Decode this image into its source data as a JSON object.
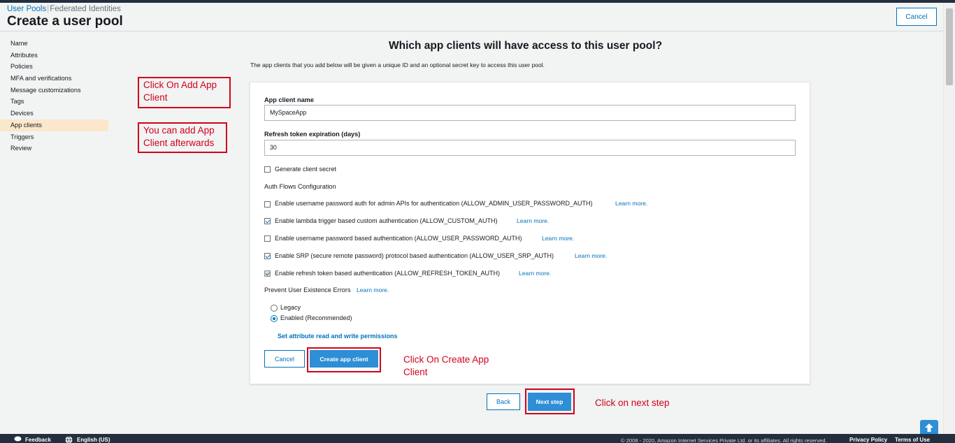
{
  "breadcrumb": {
    "user_pools": "User Pools",
    "federated": "Federated Identities"
  },
  "page_title": "Create a user pool",
  "header": {
    "cancel": "Cancel"
  },
  "sidebar": {
    "items": [
      {
        "label": "Name"
      },
      {
        "label": "Attributes"
      },
      {
        "label": "Policies"
      },
      {
        "label": "MFA and verifications"
      },
      {
        "label": "Message customizations"
      },
      {
        "label": "Tags"
      },
      {
        "label": "Devices"
      },
      {
        "label": "App clients",
        "active": true
      },
      {
        "label": "Triggers"
      },
      {
        "label": "Review"
      }
    ]
  },
  "annotations": {
    "add_app_client": "Click On Add App Client",
    "add_afterwards": "You can add App Client afterwards",
    "create_app_client": "Click On Create App Client",
    "next_step": "Click on next step"
  },
  "main": {
    "title": "Which app clients will have access to this user pool?",
    "description": "The app clients that you add below will be given a unique ID and an optional secret key to access this user pool."
  },
  "form": {
    "app_client_name_label": "App client name",
    "app_client_name_value": "MySpaceApp",
    "refresh_label": "Refresh token expiration (days)",
    "refresh_value": "30",
    "generate_secret": "Generate client secret",
    "auth_flows_heading": "Auth Flows Configuration",
    "auth_flows": [
      {
        "label": "Enable username password auth for admin APIs for authentication (ALLOW_ADMIN_USER_PASSWORD_AUTH)",
        "checked": false,
        "learn": "Learn more."
      },
      {
        "label": "Enable lambda trigger based custom authentication (ALLOW_CUSTOM_AUTH)",
        "checked": true,
        "learn": "Learn more."
      },
      {
        "label": "Enable username password based authentication (ALLOW_USER_PASSWORD_AUTH)",
        "checked": false,
        "learn": "Learn more."
      },
      {
        "label": "Enable SRP (secure remote password) protocol based authentication (ALLOW_USER_SRP_AUTH)",
        "checked": true,
        "learn": "Learn more."
      },
      {
        "label": "Enable refresh token based authentication (ALLOW_REFRESH_TOKEN_AUTH)",
        "checked": true,
        "disabled": true,
        "learn": "Learn more."
      }
    ],
    "prevent_errors_label": "Prevent User Existence Errors",
    "prevent_learn": "Learn more.",
    "radio_legacy": "Legacy",
    "radio_enabled": "Enabled (Recommended)",
    "attr_perm_link": "Set attribute read and write permissions",
    "cancel_button": "Cancel",
    "create_button": "Create app client"
  },
  "nav_buttons": {
    "back": "Back",
    "next": "Next step"
  },
  "footer": {
    "feedback": "Feedback",
    "language": "English (US)",
    "copyright": "© 2008 - 2020, Amazon Internet Services Private Ltd. or its affiliates. All rights reserved.",
    "privacy": "Privacy Policy",
    "terms": "Terms of Use"
  },
  "colors": {
    "accent": "#0073bb",
    "primary_button": "#2e8ed6",
    "annotation": "#d0021b",
    "active_nav": "#fbe7cb",
    "footer": "#232f3e"
  }
}
